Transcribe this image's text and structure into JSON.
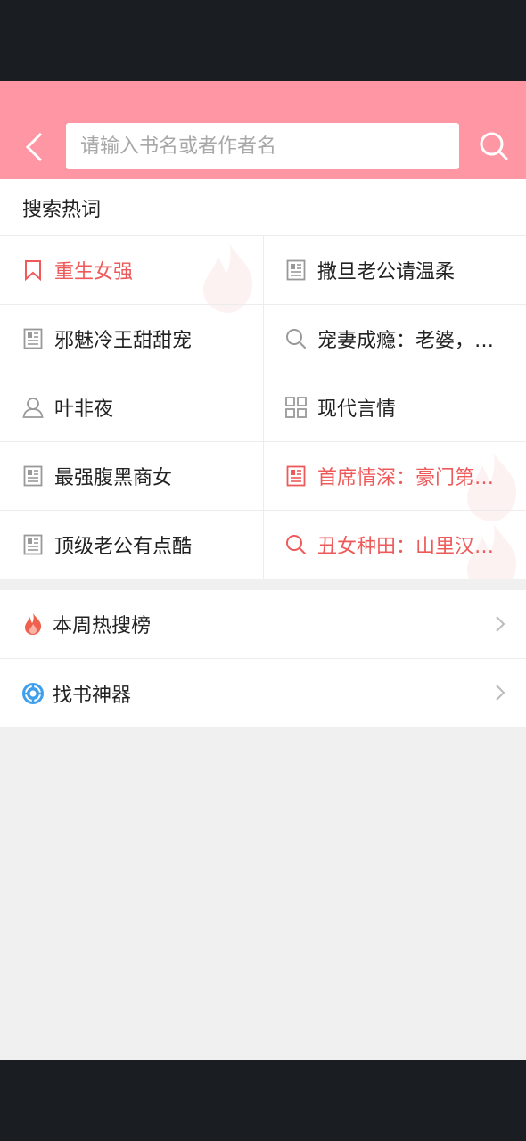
{
  "header": {
    "search_placeholder": "请输入书名或者作者名",
    "back_icon": "chevron-left-icon",
    "search_icon": "search-icon",
    "color": "#fe97a3"
  },
  "hot_words": {
    "title": "搜索热词",
    "items": [
      {
        "label": "重生女强",
        "icon": "bookmark-icon",
        "hot": true
      },
      {
        "label": "撒旦老公请温柔",
        "icon": "book-icon",
        "hot": false
      },
      {
        "label": "邪魅冷王甜甜宠",
        "icon": "book-icon",
        "hot": false
      },
      {
        "label": "宠妻成瘾：老婆，…",
        "icon": "search-icon",
        "hot": false
      },
      {
        "label": "叶非夜",
        "icon": "user-icon",
        "hot": false
      },
      {
        "label": "现代言情",
        "icon": "grid-icon",
        "hot": false
      },
      {
        "label": "最强腹黑商女",
        "icon": "book-icon",
        "hot": false
      },
      {
        "label": "首席情深：豪门第…",
        "icon": "book-icon",
        "hot": true
      },
      {
        "label": "顶级老公有点酷",
        "icon": "book-icon",
        "hot": false
      },
      {
        "label": "丑女种田：山里汉…",
        "icon": "search-icon",
        "hot": true
      }
    ],
    "hot_color": "#ee5a5a"
  },
  "menu": {
    "items": [
      {
        "label": "本周热搜榜",
        "icon": "flame-icon"
      },
      {
        "label": "找书神器",
        "icon": "compass-icon"
      }
    ]
  }
}
